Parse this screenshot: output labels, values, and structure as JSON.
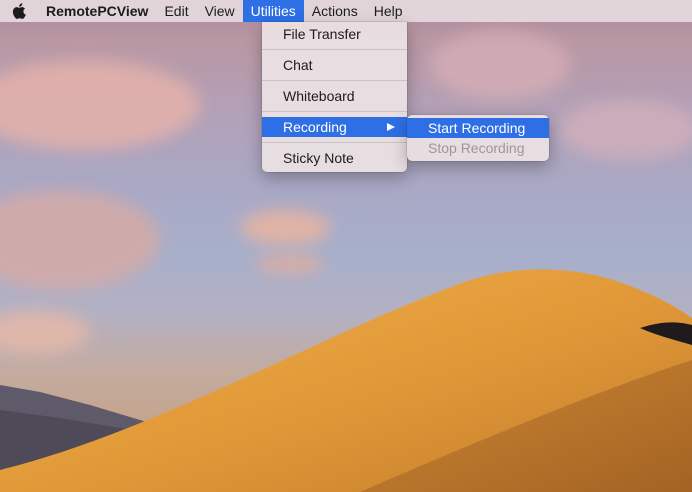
{
  "menubar": {
    "apple_icon": "apple-logo-icon",
    "app_name": "RemotePCView",
    "items": [
      "Edit",
      "View",
      "Utilities",
      "Actions",
      "Help"
    ],
    "active_item": "Utilities"
  },
  "utilities_menu": {
    "items": [
      "File Transfer",
      "Chat",
      "Whiteboard",
      "Recording",
      "Sticky Note"
    ],
    "highlighted": "Recording",
    "submenu_indicator_icon": "submenu-arrow-icon"
  },
  "recording_submenu": {
    "start": "Start Recording",
    "stop": "Stop Recording",
    "highlighted": "Start Recording",
    "disabled": "Stop Recording"
  },
  "colors": {
    "selection": "#2e6fe6",
    "menubar_bg": "#e8dee1",
    "dune_light": "#e6a43f",
    "dune_dark": "#b8712a"
  }
}
